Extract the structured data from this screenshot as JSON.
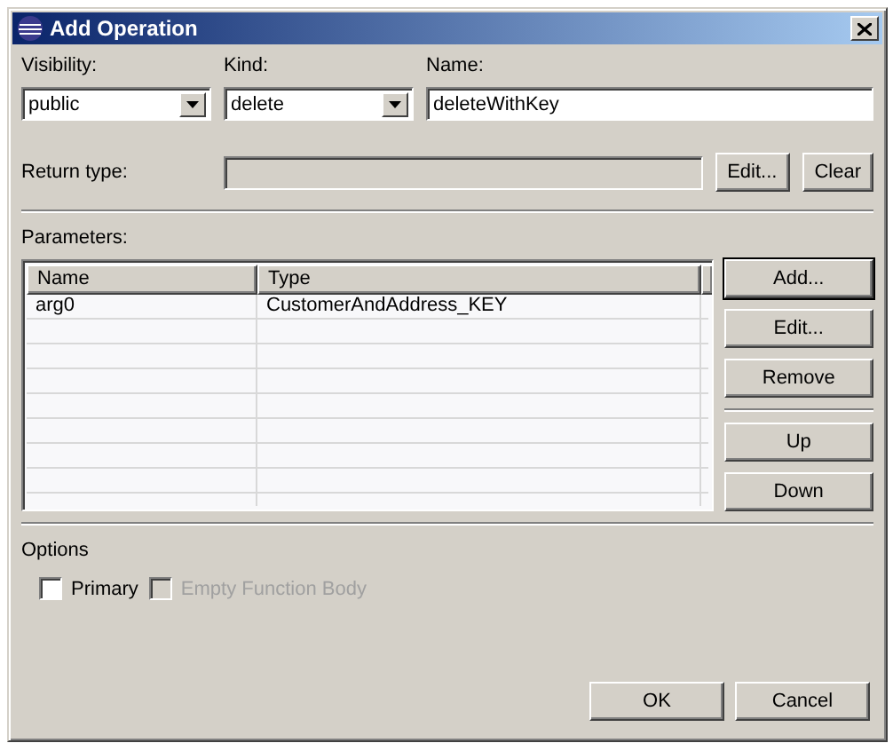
{
  "window": {
    "title": "Add Operation"
  },
  "visibility": {
    "label": "Visibility:",
    "value": "public"
  },
  "kind": {
    "label": "Kind:",
    "value": "delete"
  },
  "name": {
    "label": "Name:",
    "value": "deleteWithKey"
  },
  "return_type": {
    "label": "Return type:",
    "buttons": [
      "Edit...",
      "Clear"
    ]
  },
  "parameters": {
    "label": "Parameters:",
    "columns": [
      "Name",
      "Type"
    ],
    "rows": [
      {
        "name": "arg0",
        "type": "CustomerAndAddress_KEY"
      }
    ],
    "buttons": [
      {
        "label": "Add...",
        "default": true
      },
      {
        "label": "Edit...",
        "default": false
      },
      {
        "label": "Remove",
        "default": false
      },
      {
        "label": "Up",
        "default": false
      },
      {
        "label": "Down",
        "default": false
      }
    ]
  },
  "options": {
    "label": "Options",
    "checkboxes": [
      {
        "label": "Primary",
        "checked": false,
        "disabled": false
      },
      {
        "label": "Empty Function Body",
        "checked": false,
        "disabled": true
      }
    ]
  },
  "footer_buttons": [
    "OK",
    "Cancel"
  ]
}
